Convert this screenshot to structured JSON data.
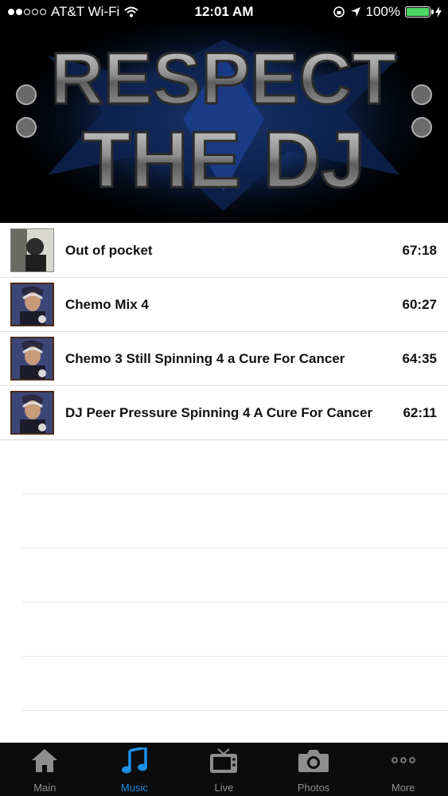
{
  "status_bar": {
    "carrier": "AT&T Wi-Fi",
    "time": "12:01 AM",
    "battery": "100%",
    "battery_level": 1.0
  },
  "banner": {
    "line1": "RESPECT",
    "line2": "THE DJ"
  },
  "tracks": [
    {
      "title": "Out of pocket",
      "duration": "67:18"
    },
    {
      "title": "Chemo Mix 4",
      "duration": "60:27"
    },
    {
      "title": "Chemo 3 Still Spinning 4 a Cure For Cancer",
      "duration": "64:35"
    },
    {
      "title": "DJ Peer Pressure Spinning 4 A Cure For Cancer",
      "duration": "62:11"
    }
  ],
  "tabs": [
    {
      "label": "Main",
      "icon": "home-icon"
    },
    {
      "label": "Music",
      "icon": "music-note-icon",
      "active": true
    },
    {
      "label": "Live",
      "icon": "tv-icon"
    },
    {
      "label": "Photos",
      "icon": "camera-icon"
    },
    {
      "label": "More",
      "icon": "more-dots-icon"
    }
  ],
  "colors": {
    "active_tab": "#1e8fe6",
    "inactive_tab": "#8e8e8e",
    "tab_bar_bg": "#0c0c0c",
    "battery": "#4cd964"
  }
}
